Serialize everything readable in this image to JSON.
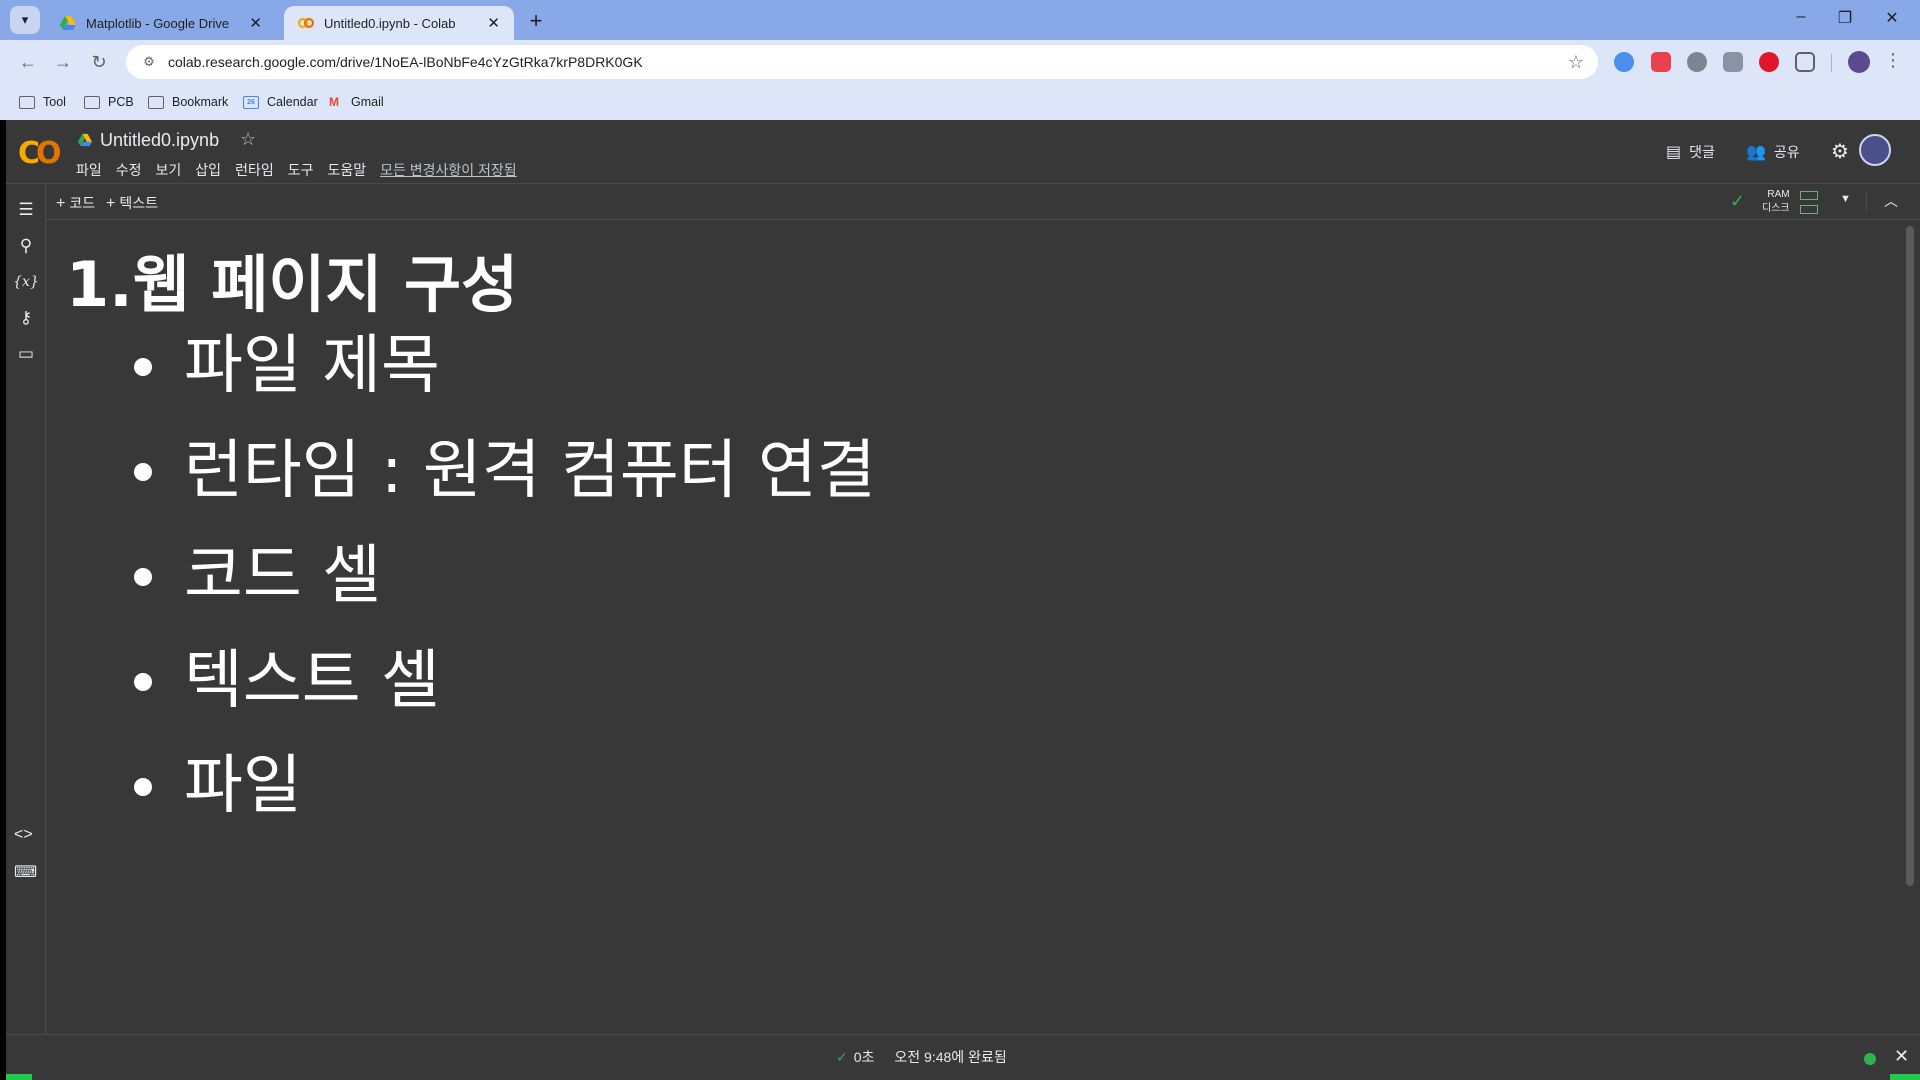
{
  "browser": {
    "tabs": [
      {
        "title": "Matplotlib - Google Drive",
        "active": false
      },
      {
        "title": "Untitled0.ipynb - Colab",
        "active": true
      }
    ],
    "url": "colab.research.google.com/drive/1NoEA-lBoNbFe4cYzGtRka7krP8DRK0GK",
    "bookmarks": [
      {
        "label": "Tool",
        "icon": "folder-icon"
      },
      {
        "label": "PCB",
        "icon": "folder-icon"
      },
      {
        "label": "Bookmark",
        "icon": "folder-icon"
      },
      {
        "label": "Calendar",
        "icon": "calendar-icon"
      },
      {
        "label": "Gmail",
        "icon": "gmail-icon"
      }
    ],
    "calendar_day": "26"
  },
  "colab": {
    "notebook_title": "Untitled0.ipynb",
    "menu": [
      "파일",
      "수정",
      "보기",
      "삽입",
      "런타임",
      "도구",
      "도움말"
    ],
    "saved_status": "모든 변경사항이 저장됨",
    "comment_label": "댓글",
    "share_label": "공유",
    "add_code_label": "코드",
    "add_text_label": "텍스트",
    "ram_label": "RAM",
    "disk_label": "디스크"
  },
  "cell": {
    "heading": "1.웹 페이지 구성",
    "bullets": [
      "파일 제목",
      "런타임 : 원격 컴퓨터 연결",
      "코드 셀",
      "텍스트 셀",
      "파일"
    ]
  },
  "status": {
    "duration": "0초",
    "completed": "오전 9:48에 완료됨"
  },
  "colors": {
    "accent_orange": "#f9ab00",
    "status_green": "#2eb34e",
    "background": "#383838"
  }
}
